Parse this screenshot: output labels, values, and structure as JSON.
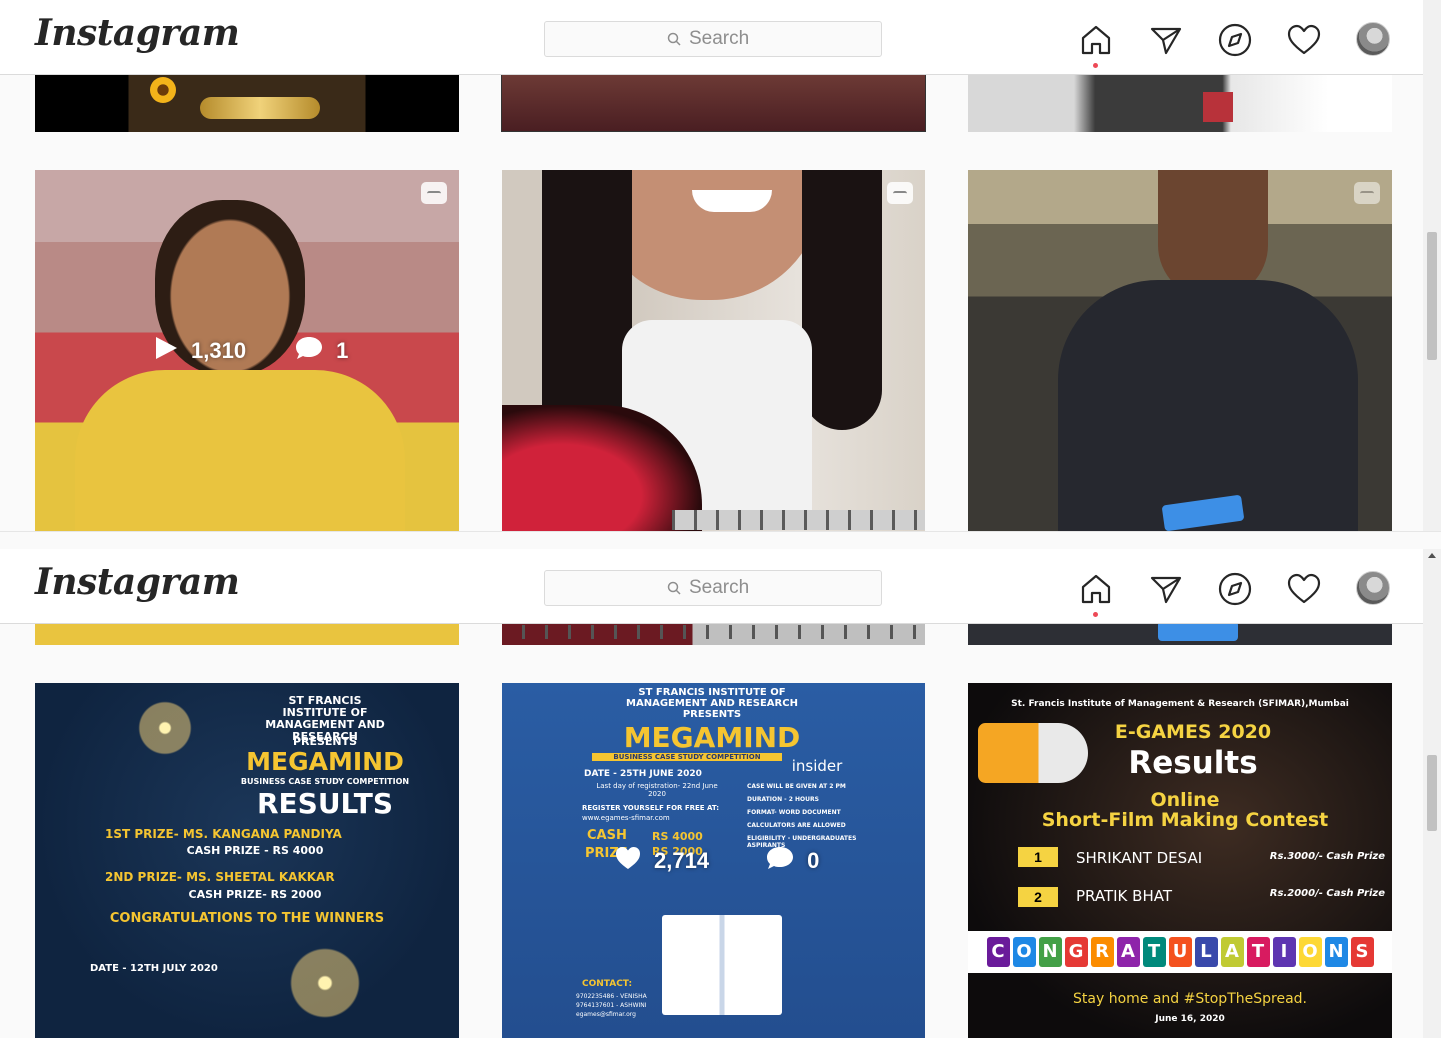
{
  "app": {
    "logo": "Instagram",
    "search_placeholder": "Search",
    "nav_icons": [
      "home-icon",
      "direct-icon",
      "explore-icon",
      "activity-icon",
      "profile-avatar"
    ]
  },
  "top": {
    "tiles": [
      {
        "name": "video-tile-1",
        "views": "1,310",
        "comments": "1"
      },
      {
        "name": "video-tile-2"
      },
      {
        "name": "video-tile-3"
      }
    ]
  },
  "bottom": {
    "post1": {
      "org": "ST FRANCIS INSTITUTE OF MANAGEMENT AND RESEARCH",
      "presents": "PRESENTS",
      "title": "MEGAMIND",
      "subtitle": "BUSINESS CASE STUDY COMPETITION",
      "results": "RESULTS",
      "prize1": "1ST PRIZE- MS. KANGANA PANDIYA",
      "prize1_cash": "CASH PRIZE - RS 4000",
      "prize2": "2ND PRIZE- MS. SHEETAL KAKKAR",
      "prize2_cash": "CASH PRIZE- RS 2000",
      "congrats": "CONGRATULATIONS TO THE WINNERS",
      "date": "DATE - 12TH JULY 2020"
    },
    "post2": {
      "org": "ST FRANCIS INSTITUTE OF MANAGEMENT AND RESEARCH",
      "presents": "PRESENTS",
      "title": "MEGAMIND",
      "subtitle": "BUSINESS CASE STUDY COMPETITION",
      "sponsor": "insider",
      "date": "DATE - 25TH JUNE 2020",
      "last_day": "Last day of registration- 22nd June 2020",
      "register": "REGISTER YOURSELF FOR FREE AT:",
      "url": "www.egames-sfimar.com",
      "cash": "CASH",
      "prize_label": "PRIZE",
      "prize1": "RS 4000",
      "prize2": "RS 2000",
      "rules": [
        "CASE WILL BE GIVEN AT 2 PM",
        "DURATION - 2 HOURS",
        "FORMAT- WORD DOCUMENT",
        "CALCULATORS ARE ALLOWED",
        "ELIGIBILITY - UNDERGRADUATES ASPIRANTS"
      ],
      "contact": "CONTACT:",
      "contact_lines": [
        "9702235486 - VENISHA",
        "9764137601 - ASHWINI",
        "egames@sfimar.org"
      ],
      "likes": "2,714",
      "comments": "0"
    },
    "post3": {
      "org": "St. Francis Institute of Management & Research (SFIMAR),Mumbai",
      "event": "E-GAMES 2020",
      "results": "Results",
      "online": "Online",
      "contest": "Short-Film Making Contest",
      "winners": [
        {
          "rank": "1",
          "name": "SHRIKANT DESAI",
          "prize": "Rs.3000/- Cash Prize"
        },
        {
          "rank": "2",
          "name": "PRATIK BHAT",
          "prize": "Rs.2000/- Cash Prize"
        }
      ],
      "banner_letters": [
        "C",
        "O",
        "N",
        "G",
        "R",
        "A",
        "T",
        "U",
        "L",
        "A",
        "T",
        "I",
        "O",
        "N",
        "S"
      ],
      "banner_colors": [
        "#6a1b9a",
        "#1e88e5",
        "#43a047",
        "#e53935",
        "#fb8c00",
        "#8e24aa",
        "#00897b",
        "#f4511e",
        "#3949ab",
        "#c0ca33",
        "#d81b60",
        "#5e35b1",
        "#fdd835",
        "#1e88e5",
        "#e53935"
      ],
      "stay_home": "Stay home and #StopTheSpread.",
      "date": "June 16, 2020"
    }
  }
}
